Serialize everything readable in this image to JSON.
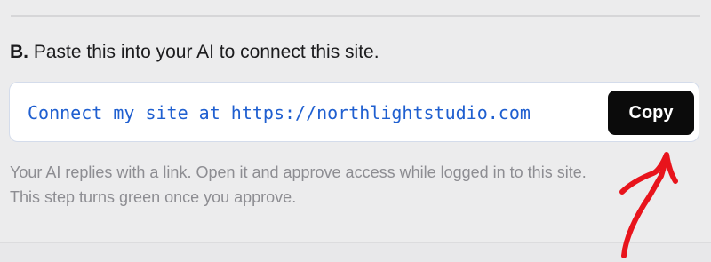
{
  "step": {
    "letter": "B.",
    "instruction": "Paste this into your AI to connect this site."
  },
  "command": {
    "text": "Connect my site at https://northlightstudio.com",
    "copy_label": "Copy"
  },
  "help": {
    "line1": "Your AI replies with a link. Open it and approve access while logged in to this site.",
    "line2": "This step turns green once you approve."
  },
  "colors": {
    "background": "#ececed",
    "command_text": "#1f5fd0",
    "copy_button": "#0b0b0b",
    "help_text": "#8d8d92",
    "annotation_arrow": "#e8141c"
  },
  "annotation": {
    "icon": "red-arrow-icon"
  }
}
